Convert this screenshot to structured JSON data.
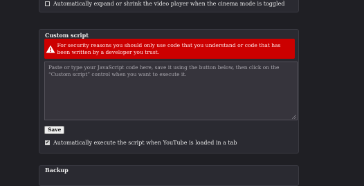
{
  "cinema": {
    "option_label": "Automatically expand or shrink the video player when the cinema mode is toggled"
  },
  "custom_script": {
    "title": "Custom script",
    "warning": "For security reasons you should only use code that you understand or code that has been written by a developer you trust.",
    "code_placeholder": "Paste or type your JavaScript code here, save it using the button below, then click on the “Custom script” control when you want to execute it.",
    "save_label": "Save",
    "autoexec_label": "Automatically execute the script when YouTube is loaded in a tab",
    "autoexec_checked": true
  },
  "backup": {
    "title": "Backup"
  },
  "colors": {
    "warning_bg": "#cc0000",
    "page_bg": "#1f1f24",
    "card_bg": "#2a2a31"
  }
}
